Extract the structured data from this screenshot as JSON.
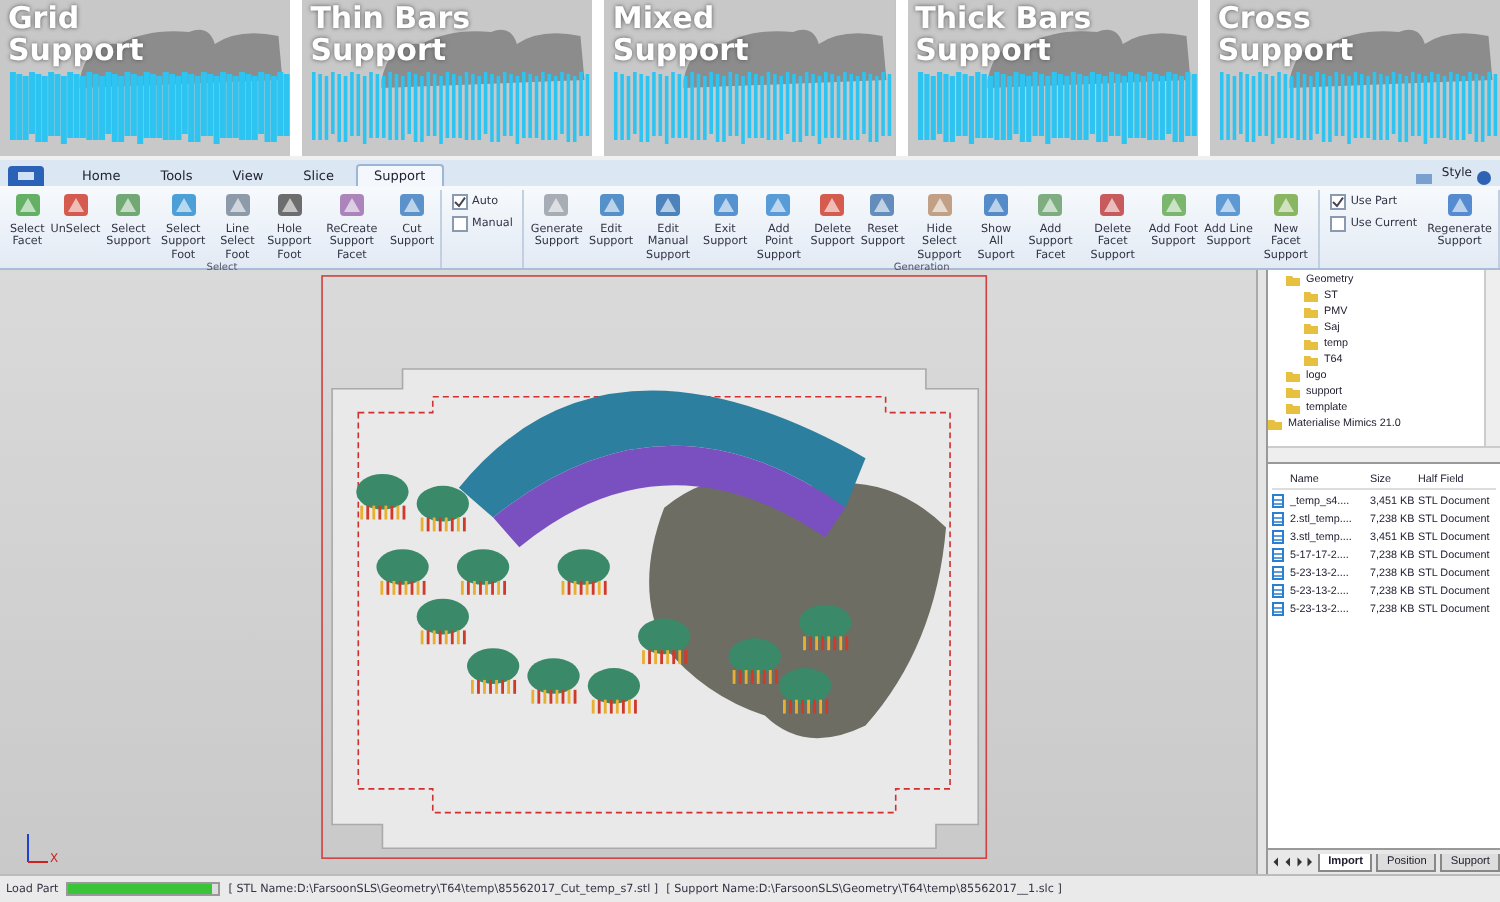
{
  "banner": [
    {
      "label": "Grid Support"
    },
    {
      "label": "Thin Bars Support"
    },
    {
      "label": "Mixed Support"
    },
    {
      "label": "Thick Bars Support"
    },
    {
      "label": "Cross Support"
    }
  ],
  "menu_tabs": [
    {
      "label": "Home",
      "selected": false
    },
    {
      "label": "Tools",
      "selected": false
    },
    {
      "label": "View",
      "selected": false
    },
    {
      "label": "Slice",
      "selected": false
    },
    {
      "label": "Support",
      "selected": true
    }
  ],
  "style_menu": {
    "label": "Style"
  },
  "ribbon": {
    "groups": [
      {
        "label": "Select",
        "items": [
          {
            "kind": "button",
            "label": "Select Facet"
          },
          {
            "kind": "button",
            "label": "UnSelect"
          },
          {
            "kind": "button",
            "label": "Select Support"
          },
          {
            "kind": "button",
            "label": "Select Support Foot"
          },
          {
            "kind": "button",
            "label": "Line Select Foot"
          },
          {
            "kind": "button",
            "label": "Hole Support Foot"
          },
          {
            "kind": "button",
            "label": "ReCreate Support Facet"
          },
          {
            "kind": "button",
            "label": "Cut Support"
          }
        ]
      },
      {
        "items": [
          {
            "kind": "checks",
            "options": [
              {
                "label": "Auto",
                "checked": true
              },
              {
                "label": "Manual",
                "checked": false
              }
            ]
          }
        ]
      },
      {
        "label": "Generation",
        "items": [
          {
            "kind": "button",
            "label": "Generate Support"
          },
          {
            "kind": "button",
            "label": "Edit Support"
          },
          {
            "kind": "button",
            "label": "Edit Manual Support"
          },
          {
            "kind": "button",
            "label": "Exit Support"
          },
          {
            "kind": "button",
            "label": "Add Point Support"
          },
          {
            "kind": "button",
            "label": "Delete Support"
          },
          {
            "kind": "button",
            "label": "Reset Support"
          },
          {
            "kind": "button",
            "label": "Hide Select Support"
          },
          {
            "kind": "button",
            "label": "Show All Suport"
          },
          {
            "kind": "button",
            "label": "Add Support Facet"
          },
          {
            "kind": "button",
            "label": "Delete Facet Support"
          },
          {
            "kind": "button",
            "label": "Add Foot Support"
          },
          {
            "kind": "button",
            "label": "Add Line Support"
          },
          {
            "kind": "button",
            "label": "New Facet Support"
          }
        ]
      },
      {
        "items": [
          {
            "kind": "checks",
            "options": [
              {
                "label": "Use Part",
                "checked": true
              },
              {
                "label": "Use Current",
                "checked": false
              }
            ]
          },
          {
            "kind": "button",
            "label": "Regenerate Support"
          }
        ]
      }
    ]
  },
  "viewport": {
    "axis_label": "X"
  },
  "side_panel": {
    "tree": [
      {
        "children": [
          {
            "label": "Geometry",
            "children": [
              {
                "label": "ST"
              },
              {
                "label": "PMV"
              },
              {
                "label": "Saj"
              },
              {
                "label": "temp"
              },
              {
                "label": "T64"
              }
            ]
          },
          {
            "label": "logo"
          },
          {
            "label": "support"
          },
          {
            "label": "template"
          }
        ]
      },
      {
        "label": "Materialise Mimics 21.0"
      }
    ],
    "file_list": {
      "columns": [
        "Name",
        "Size",
        "Half Field"
      ],
      "rows": [
        [
          "_temp_s4....",
          "3,451 KB",
          "STL Document"
        ],
        [
          "2.stl_temp....",
          "7,238 KB",
          "STL Document"
        ],
        [
          "3.stl_temp....",
          "3,451 KB",
          "STL Document"
        ],
        [
          "5-17-17-2....",
          "7,238 KB",
          "STL Document"
        ],
        [
          "5-23-13-2....",
          "7,238 KB",
          "STL Document"
        ],
        [
          "5-23-13-2....",
          "7,238 KB",
          "STL Document"
        ],
        [
          "5-23-13-2....",
          "7,238 KB",
          "STL Document"
        ]
      ]
    },
    "bottom_tabs": [
      {
        "label": "Import",
        "selected": true
      },
      {
        "label": "Position",
        "selected": false
      },
      {
        "label": "Support",
        "selected": false
      }
    ]
  },
  "status_bar": {
    "label": "Load Part",
    "level": 0.96,
    "stl_name": "[ STL Name:D:\\FarsoonSLS\\Geometry\\T64\\temp\\85562017_Cut_temp_s7.stl ]",
    "support_name": "[ Support Name:D:\\FarsoonSLS\\Geometry\\T64\\temp\\85562017__1.slc ]"
  }
}
